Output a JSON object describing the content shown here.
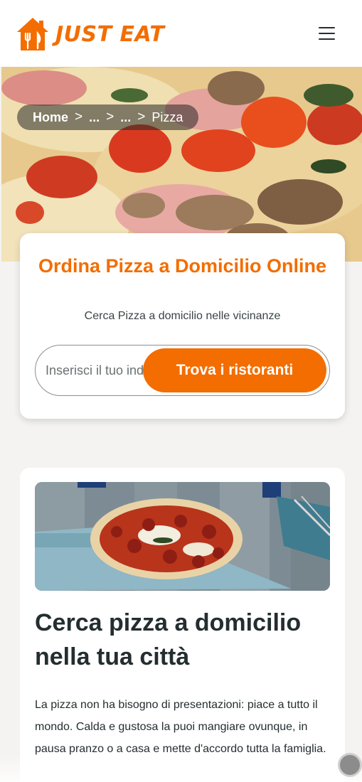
{
  "header": {
    "logo_text": "JUST EAT",
    "logo_icon": "house-fork-knife-icon",
    "menu_icon": "hamburger-menu-icon"
  },
  "breadcrumb": {
    "home": "Home",
    "level2": "...",
    "level3": "...",
    "current": "Pizza",
    "separator": ">"
  },
  "search": {
    "title": "Ordina Pizza a Domicilio Online",
    "subtitle": "Cerca Pizza a domicilio nelle vicinanze",
    "placeholder": "Inserisci il tuo indirizzo",
    "button_label": "Trova i ristoranti"
  },
  "article": {
    "title": "Cerca pizza a domicilio nella tua città",
    "body": "La pizza non ha bisogno di presentazioni: piace a tutto il mondo. Calda e gustosa la puoi mangiare ovunque, in pausa pranzo o a casa e mette d'accordo tutta la famiglia."
  },
  "colors": {
    "brand_orange": "#f36d00",
    "text_dark": "#242e30",
    "page_bg": "#f5f3f1"
  }
}
